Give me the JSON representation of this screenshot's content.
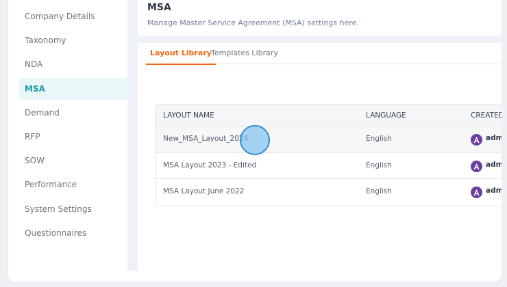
{
  "sidebar": {
    "items": [
      {
        "label": "Company Details"
      },
      {
        "label": "Taxonomy"
      },
      {
        "label": "NDA"
      },
      {
        "label": "MSA"
      },
      {
        "label": "Demand"
      },
      {
        "label": "RFP"
      },
      {
        "label": "SOW"
      },
      {
        "label": "Performance"
      },
      {
        "label": "System Settings"
      },
      {
        "label": "Questionnaires"
      }
    ],
    "active": "MSA"
  },
  "header": {
    "title": "MSA",
    "subtitle": "Manage Master Service Agreement (MSA) settings here."
  },
  "tabs": [
    {
      "label": "Layout Library",
      "active": true
    },
    {
      "label": "Templates Library",
      "active": false
    }
  ],
  "table": {
    "headers": [
      "LAYOUT NAME",
      "LANGUAGE",
      "CREATED"
    ],
    "rows": [
      {
        "name": "New_MSA_Layout_2024",
        "language": "English",
        "creator": "adm"
      },
      {
        "name": "MSA Layout 2023 - Edited",
        "language": "English",
        "creator": "adm"
      },
      {
        "name": "MSA Layout June 2022",
        "language": "English",
        "creator": "adm"
      }
    ]
  },
  "colors": {
    "accent_orange": "#f06a15",
    "active_teal": "#1b9db0",
    "avatar_purple": "#6b3fa0"
  }
}
